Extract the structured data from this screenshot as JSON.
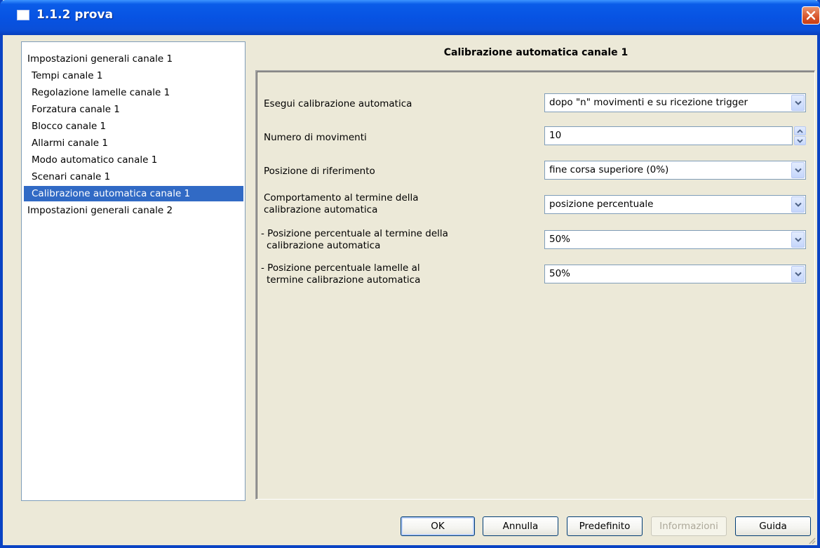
{
  "window": {
    "title": "1.1.2 prova"
  },
  "tree": {
    "items": [
      {
        "label": "Impostazioni generali canale 1",
        "level": 0
      },
      {
        "label": "Tempi canale 1",
        "level": 1
      },
      {
        "label": "Regolazione lamelle canale 1",
        "level": 1
      },
      {
        "label": "Forzatura canale 1",
        "level": 1
      },
      {
        "label": "Blocco canale 1",
        "level": 1
      },
      {
        "label": "Allarmi canale 1",
        "level": 1
      },
      {
        "label": "Modo automatico canale 1",
        "level": 1
      },
      {
        "label": "Scenari canale 1",
        "level": 1
      },
      {
        "label": "Calibrazione automatica canale 1",
        "level": 1,
        "selected": true
      },
      {
        "label": "Impostazioni generali canale 2",
        "level": 0
      }
    ]
  },
  "panel": {
    "title": "Calibrazione automatica canale 1",
    "params": [
      {
        "label_line1": "Esegui calibrazione automatica",
        "label_line2": "",
        "control": "dropdown",
        "value": "dopo \"n\" movimenti e su ricezione trigger"
      },
      {
        "label_line1": "Numero di movimenti",
        "label_line2": "",
        "control": "spinner",
        "value": "10"
      },
      {
        "label_line1": "Posizione di riferimento",
        "label_line2": "",
        "control": "dropdown",
        "value": "fine corsa superiore (0%)"
      },
      {
        "label_line1": "Comportamento al termine della",
        "label_line2": "calibrazione automatica",
        "control": "dropdown",
        "value": "posizione percentuale"
      },
      {
        "label_line1": "- Posizione percentuale al termine della",
        "label_line2": "  calibrazione automatica",
        "control": "dropdown",
        "value": "50%"
      },
      {
        "label_line1": "- Posizione percentuale lamelle al",
        "label_line2": "  termine calibrazione automatica",
        "control": "dropdown",
        "value": "50%"
      }
    ]
  },
  "buttons": {
    "ok": "OK",
    "cancel": "Annulla",
    "default": "Predefinito",
    "info": "Informazioni",
    "help": "Guida"
  },
  "colors": {
    "titlebar": "#0753e3",
    "selection": "#316ac5",
    "close": "#d9552c"
  }
}
